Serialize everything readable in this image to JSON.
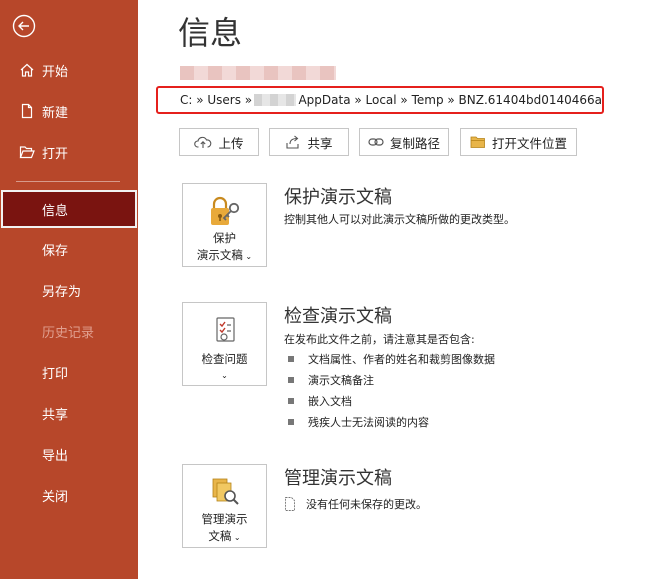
{
  "sidebar": {
    "items": [
      {
        "label": "开始",
        "icon": "home-icon"
      },
      {
        "label": "新建",
        "icon": "new-file-icon"
      },
      {
        "label": "打开",
        "icon": "folder-open-icon"
      },
      {
        "label": "信息",
        "active": true
      },
      {
        "label": "保存"
      },
      {
        "label": "另存为"
      },
      {
        "label": "历史记录",
        "disabled": true
      },
      {
        "label": "打印"
      },
      {
        "label": "共享"
      },
      {
        "label": "导出"
      },
      {
        "label": "关闭"
      }
    ],
    "colors": {
      "background": "#b7472a",
      "active": "#7a1410"
    }
  },
  "main": {
    "title": "信息",
    "path": {
      "prefix": "C: » Users » ",
      "suffix": " AppData » Local » Temp » BNZ.61404bd0140466a"
    },
    "toolbar": {
      "upload": "上传",
      "share": "共享",
      "copy_path": "复制路径",
      "open_location": "打开文件位置"
    },
    "sections": {
      "protect": {
        "button_line1": "保护",
        "button_line2": "演示文稿",
        "title": "保护演示文稿",
        "desc": "控制其他人可以对此演示文稿所做的更改类型。"
      },
      "inspect": {
        "button_label": "检查问题",
        "title": "检查演示文稿",
        "desc": "在发布此文件之前，请注意其是否包含:",
        "bullets": [
          "文档属性、作者的姓名和裁剪图像数据",
          "演示文稿备注",
          "嵌入文档",
          "残疾人士无法阅读的内容"
        ]
      },
      "manage": {
        "button_line1": "管理演示",
        "button_line2": "文稿",
        "title": "管理演示文稿",
        "desc": "没有任何未保存的更改。"
      }
    }
  }
}
